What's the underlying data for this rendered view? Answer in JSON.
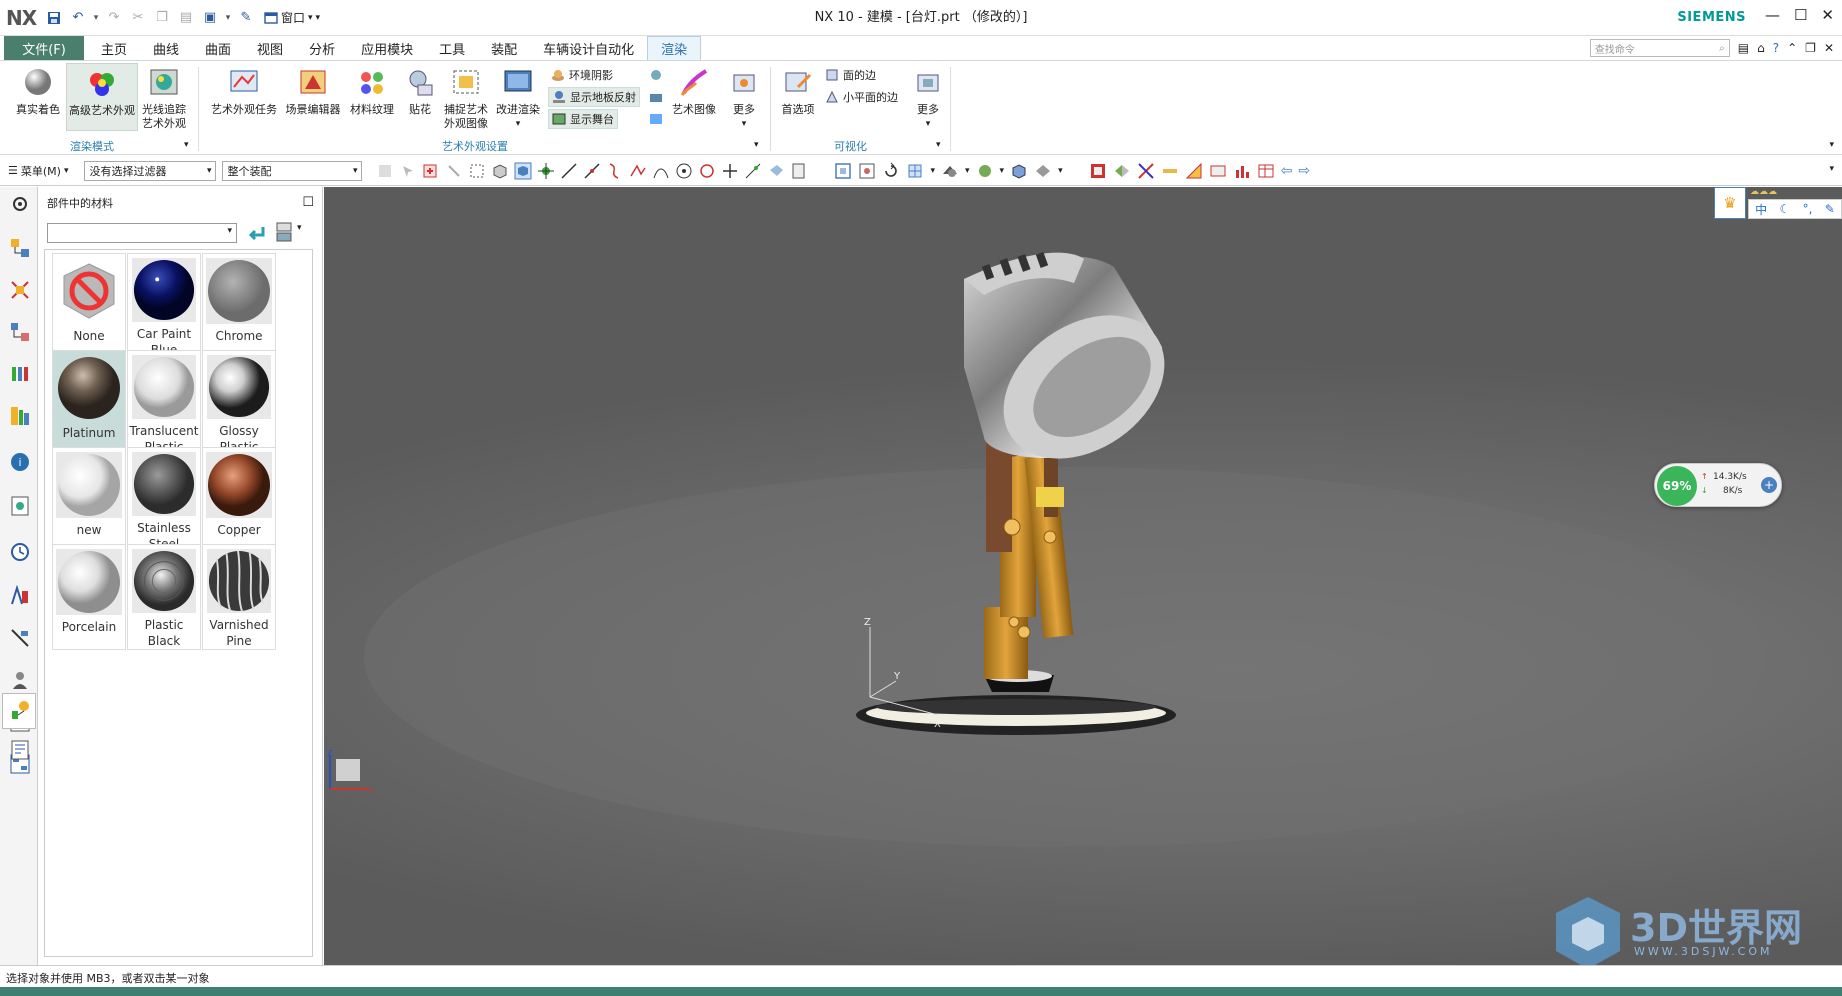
{
  "titlebar": {
    "logo": "NX",
    "window_menu": "窗口",
    "title": "NX 10 - 建模 - [台灯.prt （修改的）]",
    "brand": "SIEMENS"
  },
  "menubar": {
    "file": "文件(F)",
    "tabs": [
      "主页",
      "曲线",
      "曲面",
      "视图",
      "分析",
      "应用模块",
      "工具",
      "装配",
      "车辆设计自动化",
      "渲染"
    ],
    "search_placeholder": "查找命令"
  },
  "ribbon": {
    "render_mode": {
      "items": [
        "真实着色",
        "高级艺术外观",
        "光线追踪艺术外观"
      ],
      "group": "渲染模式"
    },
    "art_settings": {
      "items": [
        "艺术外观任务",
        "场景编辑器",
        "材料纹理",
        "贴花",
        "捕捉艺术外观图像",
        "改进渲染"
      ],
      "small": [
        "环境阴影",
        "显示地板反射",
        "显示舞台"
      ],
      "art_image": "艺术图像",
      "more": "更多",
      "group": "艺术外观设置"
    },
    "visualization": {
      "preferences": "首选项",
      "small": [
        "面的边",
        "小平面的边"
      ],
      "more": "更多",
      "group": "可视化"
    }
  },
  "toolbar": {
    "menu_label": "菜单(M)",
    "filter": "没有选择过滤器",
    "assembly_scope": "整个装配"
  },
  "panel": {
    "title": "部件中的材料",
    "materials": [
      {
        "name": "None"
      },
      {
        "name": "Car Paint Blue"
      },
      {
        "name": "Chrome"
      },
      {
        "name": "Platinum",
        "selected": true
      },
      {
        "name": "Translucent Plastic"
      },
      {
        "name": "Glossy Plastic"
      },
      {
        "name": "new"
      },
      {
        "name": "Stainless Steel"
      },
      {
        "name": "Copper"
      },
      {
        "name": "Porcelain"
      },
      {
        "name": "Plastic Black"
      },
      {
        "name": "Varnished Pine"
      }
    ]
  },
  "viewport": {
    "net_percent": "69%",
    "upload": "14.3K/s",
    "download": "8K/s",
    "ime_label": "中",
    "triad_z": "Z",
    "triad_x": "X",
    "triad_y": "Y",
    "watermark": "3D世界网",
    "watermark_url": "WWW.3DSJW.COM"
  },
  "status": {
    "text": "选择对象并使用 MB3，或者双击某一对象"
  },
  "colors": {
    "file_tab": "#4a7f6e",
    "active_tab_text": "#2a6fb0",
    "siemens": "#009999",
    "group_label": "#2a7fb0",
    "viewport_bg": "#6e6e6e"
  }
}
